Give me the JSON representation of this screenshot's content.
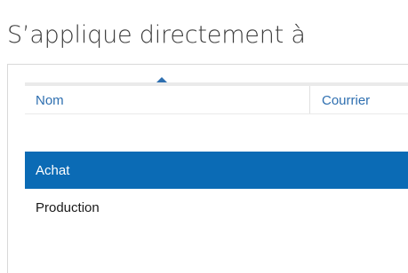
{
  "section": {
    "title": "S’applique directement à"
  },
  "table": {
    "columns": [
      {
        "label": "Nom",
        "sorted": "ascending"
      },
      {
        "label": "Courrier"
      }
    ],
    "rows": [
      {
        "name": "Achat",
        "selected": true
      },
      {
        "name": "Production",
        "selected": false
      }
    ],
    "colors": {
      "selection": "#0b6bb5",
      "header_text": "#2e6fb0"
    }
  }
}
